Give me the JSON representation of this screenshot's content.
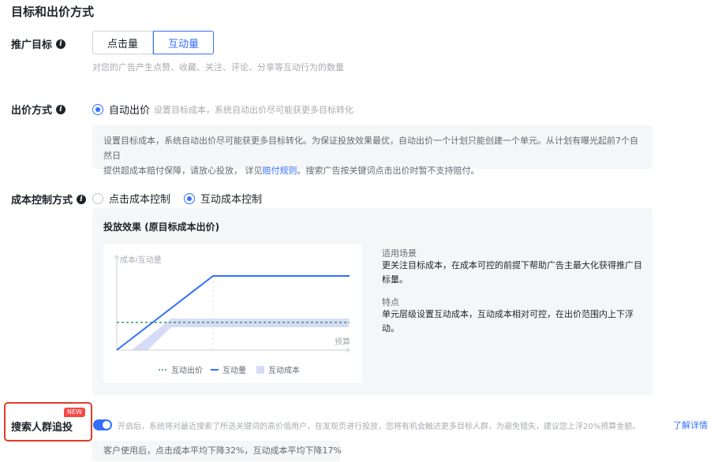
{
  "section_title": "目标和出价方式",
  "promotion_goal": {
    "label": "推广目标",
    "options": [
      "点击量",
      "互动量"
    ],
    "selected": "互动量",
    "hint": "对您的广告产生点赞、收藏、关注、评论、分享等互动行为的数量"
  },
  "bid_method": {
    "label": "出价方式",
    "option": "自动出价",
    "option_hint": "设置目标成本，系统自动出价尽可能获更多目标转化",
    "notice_line1": "设置目标成本，系统自动出价尽可能获更多目标转化。为保证投放效果最优，自动出价一个计划只能创建一个单元。从计划有曝光起前7个自然日",
    "notice_line2_pre": "提供超成本赔付保障，请放心投放， 详见",
    "notice_link": "赔付规则",
    "notice_line2_post": "。搜索广告按关键词点击出价时暂不支持赔付。"
  },
  "cost_control": {
    "label": "成本控制方式",
    "options": [
      "点击成本控制",
      "互动成本控制"
    ],
    "selected": "互动成本控制"
  },
  "effect": {
    "title": "投放效果 (原目标成本出价)",
    "chart": {
      "y_label": "成本/互动量",
      "x_label": "预算",
      "legend": [
        "互动出价",
        "互动量",
        "互动成本"
      ]
    },
    "scene_heading": "适用场景",
    "scene_text_1": "更关注目标成本，在成本可控的前提下帮助广告主最大化获得推广目",
    "scene_text_2": "标量。",
    "feature_heading": "特点",
    "feature_text_1": "单元层级设置互动成本，互动成本相对可控，在出价范围内上下浮",
    "feature_text_2": "动。"
  },
  "search_retarget": {
    "label": "搜索人群追投",
    "badge": "NEW",
    "enabled": true,
    "hint": "开启后，系统将对最近搜索了所选关键词的高价值用户，在发现页进行投放，您将有机会触达更多目标人群，为避免错失，建议您上浮20%预算金额。",
    "link": "了解详情",
    "result": "客户使用后，点击成本平均下降32%，互动成本平均下降17%"
  },
  "colors": {
    "accent": "#3370ff",
    "highlight_border": "#e03b2c",
    "bid_line": "#2f9b5f",
    "cost_band": "#d6dcf7"
  }
}
